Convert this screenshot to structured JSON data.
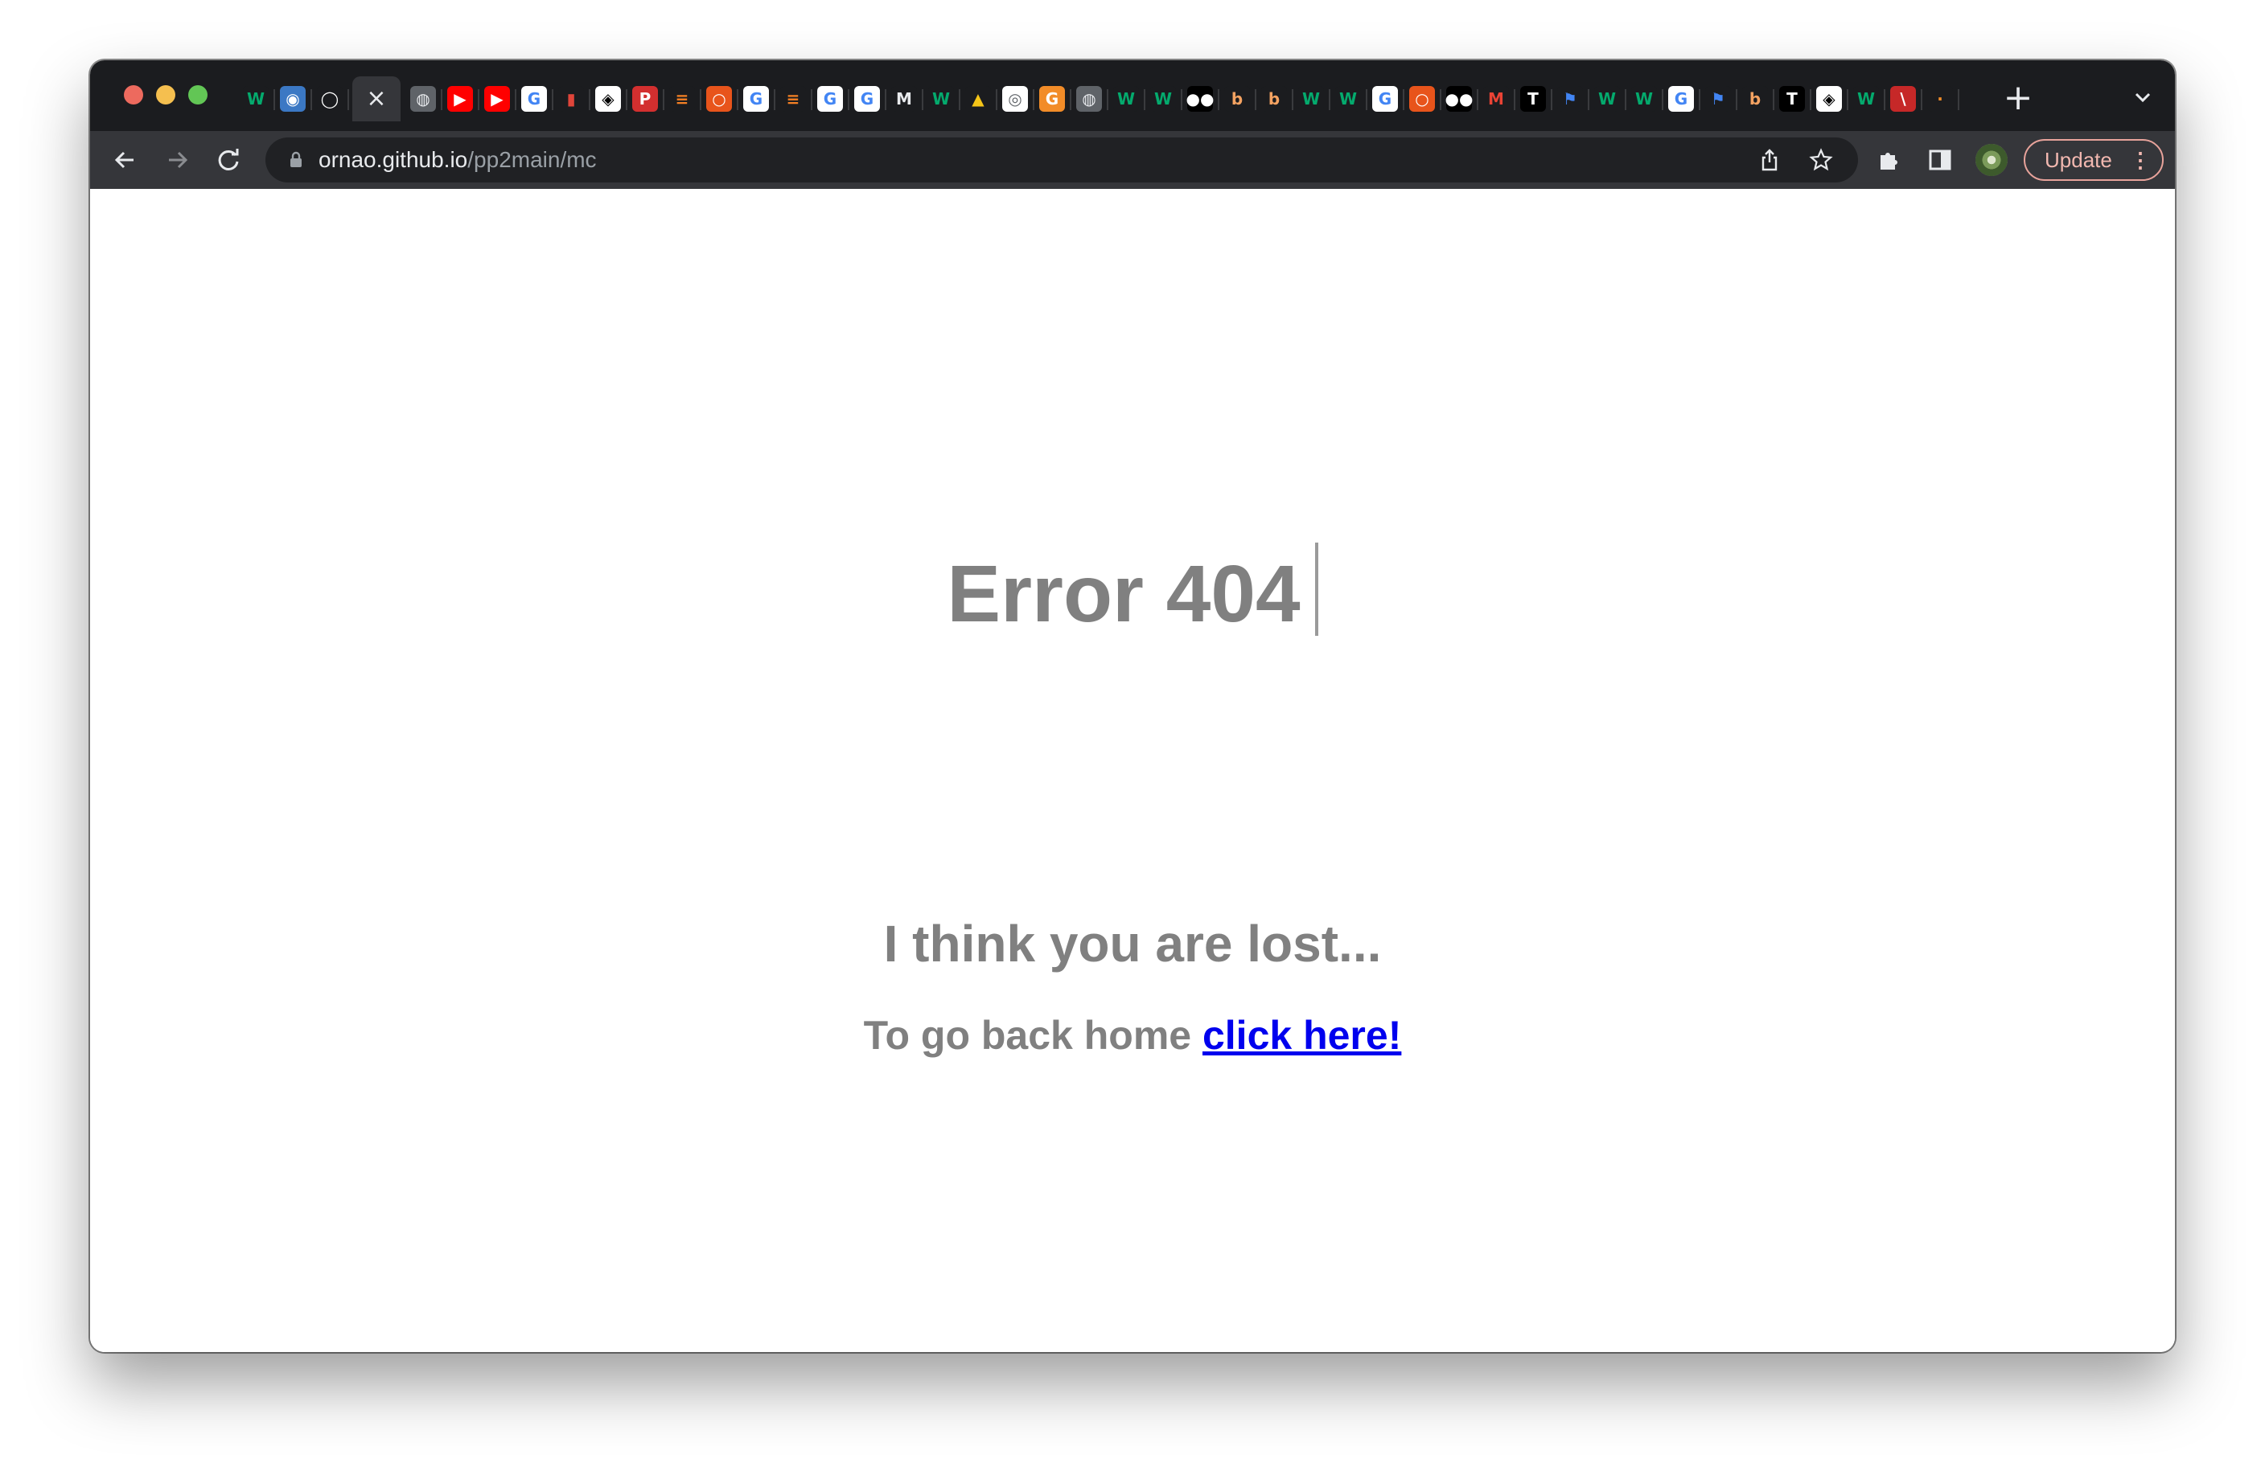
{
  "browser": {
    "tabs": [
      {
        "icon": "w3schools-icon",
        "glyph": "W",
        "bg": "#1b1c1f",
        "fg": "#04aa6d"
      },
      {
        "icon": "globe-icon",
        "glyph": "◉",
        "bg": "#3b78c4",
        "fg": "#ffffff"
      },
      {
        "icon": "github-icon",
        "glyph": "◯",
        "bg": "#1b1c1f",
        "fg": "#ffffff"
      },
      {
        "icon": "close-icon",
        "glyph": "×",
        "active": true
      },
      {
        "icon": "globe-icon",
        "glyph": "◍",
        "bg": "#5f6368",
        "fg": "#e8eaed"
      },
      {
        "icon": "youtube-icon",
        "glyph": "▶",
        "bg": "#ff0000",
        "fg": "#ffffff"
      },
      {
        "icon": "youtube-icon",
        "glyph": "▶",
        "bg": "#ff0000",
        "fg": "#ffffff"
      },
      {
        "icon": "google-icon",
        "glyph": "G",
        "bg": "#ffffff",
        "fg": "#4285f4"
      },
      {
        "icon": "bottle-icon",
        "glyph": "▮",
        "bg": "#1b1c1f",
        "fg": "#e0453a"
      },
      {
        "icon": "codepen-icon",
        "glyph": "◈",
        "bg": "#ffffff",
        "fg": "#000000"
      },
      {
        "icon": "p-icon",
        "glyph": "P",
        "bg": "#d32f2f",
        "fg": "#ffffff"
      },
      {
        "icon": "stackoverflow-icon",
        "glyph": "≡",
        "bg": "#1b1c1f",
        "fg": "#f48024"
      },
      {
        "icon": "ring-icon",
        "glyph": "○",
        "bg": "#e8541b",
        "fg": "#ffffff"
      },
      {
        "icon": "google-icon",
        "glyph": "G",
        "bg": "#ffffff",
        "fg": "#4285f4"
      },
      {
        "icon": "stackoverflow-icon",
        "glyph": "≡",
        "bg": "#1b1c1f",
        "fg": "#f48024"
      },
      {
        "icon": "google-icon",
        "glyph": "G",
        "bg": "#ffffff",
        "fg": "#4285f4"
      },
      {
        "icon": "google-icon",
        "glyph": "G",
        "bg": "#ffffff",
        "fg": "#4285f4"
      },
      {
        "icon": "m-icon",
        "glyph": "M",
        "bg": "#1b1c1f",
        "fg": "#e8eaed"
      },
      {
        "icon": "w3schools-icon",
        "glyph": "W",
        "bg": "#1b1c1f",
        "fg": "#04aa6d"
      },
      {
        "icon": "linux-icon",
        "glyph": "▲",
        "bg": "#1b1c1f",
        "fg": "#f5c518"
      },
      {
        "icon": "chrome-icon",
        "glyph": "◎",
        "bg": "#ffffff",
        "fg": "#5f6368"
      },
      {
        "icon": "g-orange-icon",
        "glyph": "G",
        "bg": "#f28c28",
        "fg": "#ffffff"
      },
      {
        "icon": "globe-icon",
        "glyph": "◍",
        "bg": "#5f6368",
        "fg": "#e8eaed"
      },
      {
        "icon": "w3schools-icon",
        "glyph": "W",
        "bg": "#1b1c1f",
        "fg": "#04aa6d"
      },
      {
        "icon": "w3schools-icon",
        "glyph": "W",
        "bg": "#1b1c1f",
        "fg": "#04aa6d"
      },
      {
        "icon": "medium-icon",
        "glyph": "●●",
        "bg": "#000000",
        "fg": "#ffffff"
      },
      {
        "icon": "b-icon",
        "glyph": "b",
        "bg": "#1b1c1f",
        "fg": "#f4a261"
      },
      {
        "icon": "b-icon",
        "glyph": "b",
        "bg": "#1b1c1f",
        "fg": "#f4a261"
      },
      {
        "icon": "w3schools-icon",
        "glyph": "W",
        "bg": "#1b1c1f",
        "fg": "#04aa6d"
      },
      {
        "icon": "w3schools-icon",
        "glyph": "W",
        "bg": "#1b1c1f",
        "fg": "#04aa6d"
      },
      {
        "icon": "google-icon",
        "glyph": "G",
        "bg": "#ffffff",
        "fg": "#4285f4"
      },
      {
        "icon": "ring-icon",
        "glyph": "○",
        "bg": "#e8541b",
        "fg": "#ffffff"
      },
      {
        "icon": "medium-icon",
        "glyph": "●●",
        "bg": "#000000",
        "fg": "#ffffff"
      },
      {
        "icon": "gmail-icon",
        "glyph": "M",
        "bg": "#1b1c1f",
        "fg": "#ea4335"
      },
      {
        "icon": "t-icon",
        "glyph": "T",
        "bg": "#000000",
        "fg": "#ffffff"
      },
      {
        "icon": "flag-icon",
        "glyph": "⚑",
        "bg": "#1b1c1f",
        "fg": "#4285f4"
      },
      {
        "icon": "w3schools-icon",
        "glyph": "W",
        "bg": "#1b1c1f",
        "fg": "#04aa6d"
      },
      {
        "icon": "w3schools-icon",
        "glyph": "W",
        "bg": "#1b1c1f",
        "fg": "#04aa6d"
      },
      {
        "icon": "google-icon",
        "glyph": "G",
        "bg": "#ffffff",
        "fg": "#4285f4"
      },
      {
        "icon": "flag-icon",
        "glyph": "⚑",
        "bg": "#1b1c1f",
        "fg": "#4285f4"
      },
      {
        "icon": "b-icon",
        "glyph": "b",
        "bg": "#1b1c1f",
        "fg": "#f4a261"
      },
      {
        "icon": "t-icon",
        "glyph": "T",
        "bg": "#000000",
        "fg": "#ffffff"
      },
      {
        "icon": "codepen-icon",
        "glyph": "◈",
        "bg": "#ffffff",
        "fg": "#000000"
      },
      {
        "icon": "w3schools-icon",
        "glyph": "W",
        "bg": "#1b1c1f",
        "fg": "#04aa6d"
      },
      {
        "icon": "striped-icon",
        "glyph": "\\",
        "bg": "#c62828",
        "fg": "#ffffff"
      },
      {
        "icon": "spark-icon",
        "glyph": "·",
        "bg": "#1b1c1f",
        "fg": "#f28c28"
      }
    ],
    "url_host": "ornao.github.io",
    "url_path": "/pp2main/mc",
    "update_label": "Update",
    "update_color": "#e8a39b"
  },
  "page": {
    "title": "Error 404",
    "subtitle": "I think you are lost...",
    "home_text": "To go back home ",
    "home_link": "click here!",
    "text_color": "#808080",
    "link_color": "#0000ee"
  }
}
